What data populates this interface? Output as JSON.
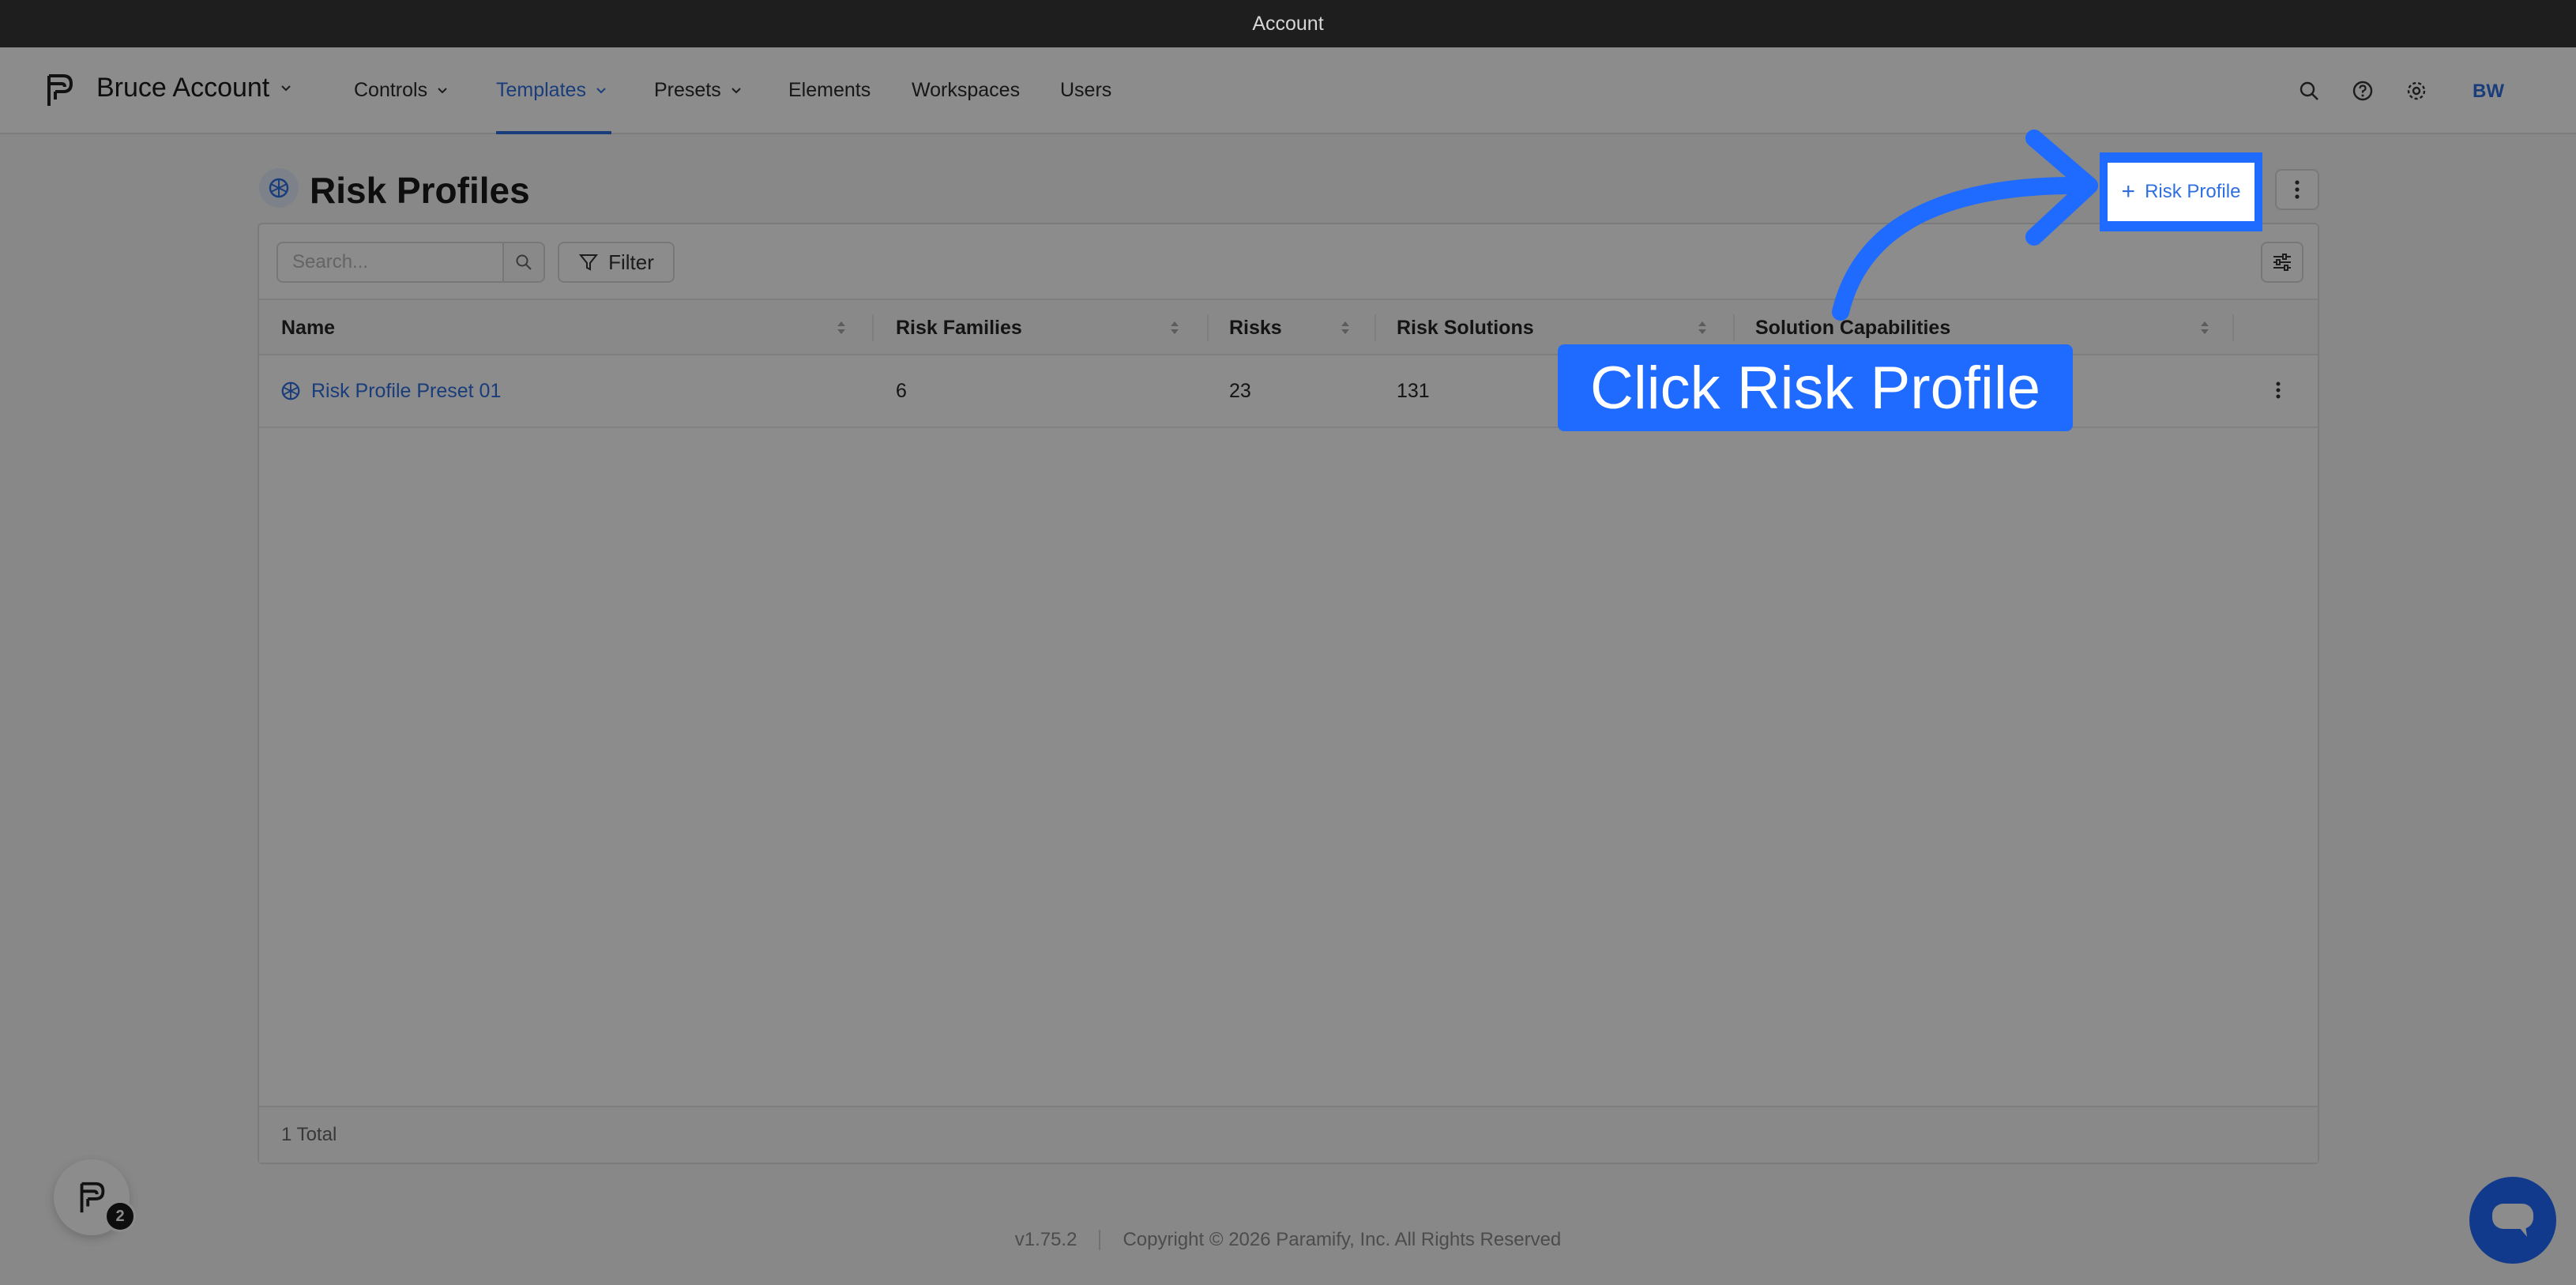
{
  "window": {
    "title": "Account"
  },
  "nav": {
    "account_name": "Bruce Account",
    "items": [
      {
        "label": "Controls"
      },
      {
        "label": "Templates"
      },
      {
        "label": "Presets"
      },
      {
        "label": "Elements"
      },
      {
        "label": "Workspaces"
      },
      {
        "label": "Users"
      }
    ],
    "user_initials": "BW"
  },
  "page": {
    "title": "Risk Profiles",
    "add_button_label": "Risk Profile"
  },
  "toolbar": {
    "search_placeholder": "Search...",
    "filter_label": "Filter"
  },
  "table": {
    "columns": [
      "Name",
      "Risk Families",
      "Risks",
      "Risk Solutions",
      "Solution Capabilities"
    ],
    "rows": [
      {
        "name": "Risk Profile Preset 01",
        "risk_families": "6",
        "risks": "23",
        "risk_solutions": "131"
      }
    ],
    "total": "1 Total"
  },
  "footer": {
    "version": "v1.75.2",
    "copyright": "Copyright © 2026 Paramify, Inc. All Rights Reserved"
  },
  "launcher": {
    "badge": "2"
  },
  "callout": {
    "text": "Click Risk Profile"
  },
  "colors": {
    "accent": "#2f6fe0",
    "highlight": "#1f6bff"
  }
}
